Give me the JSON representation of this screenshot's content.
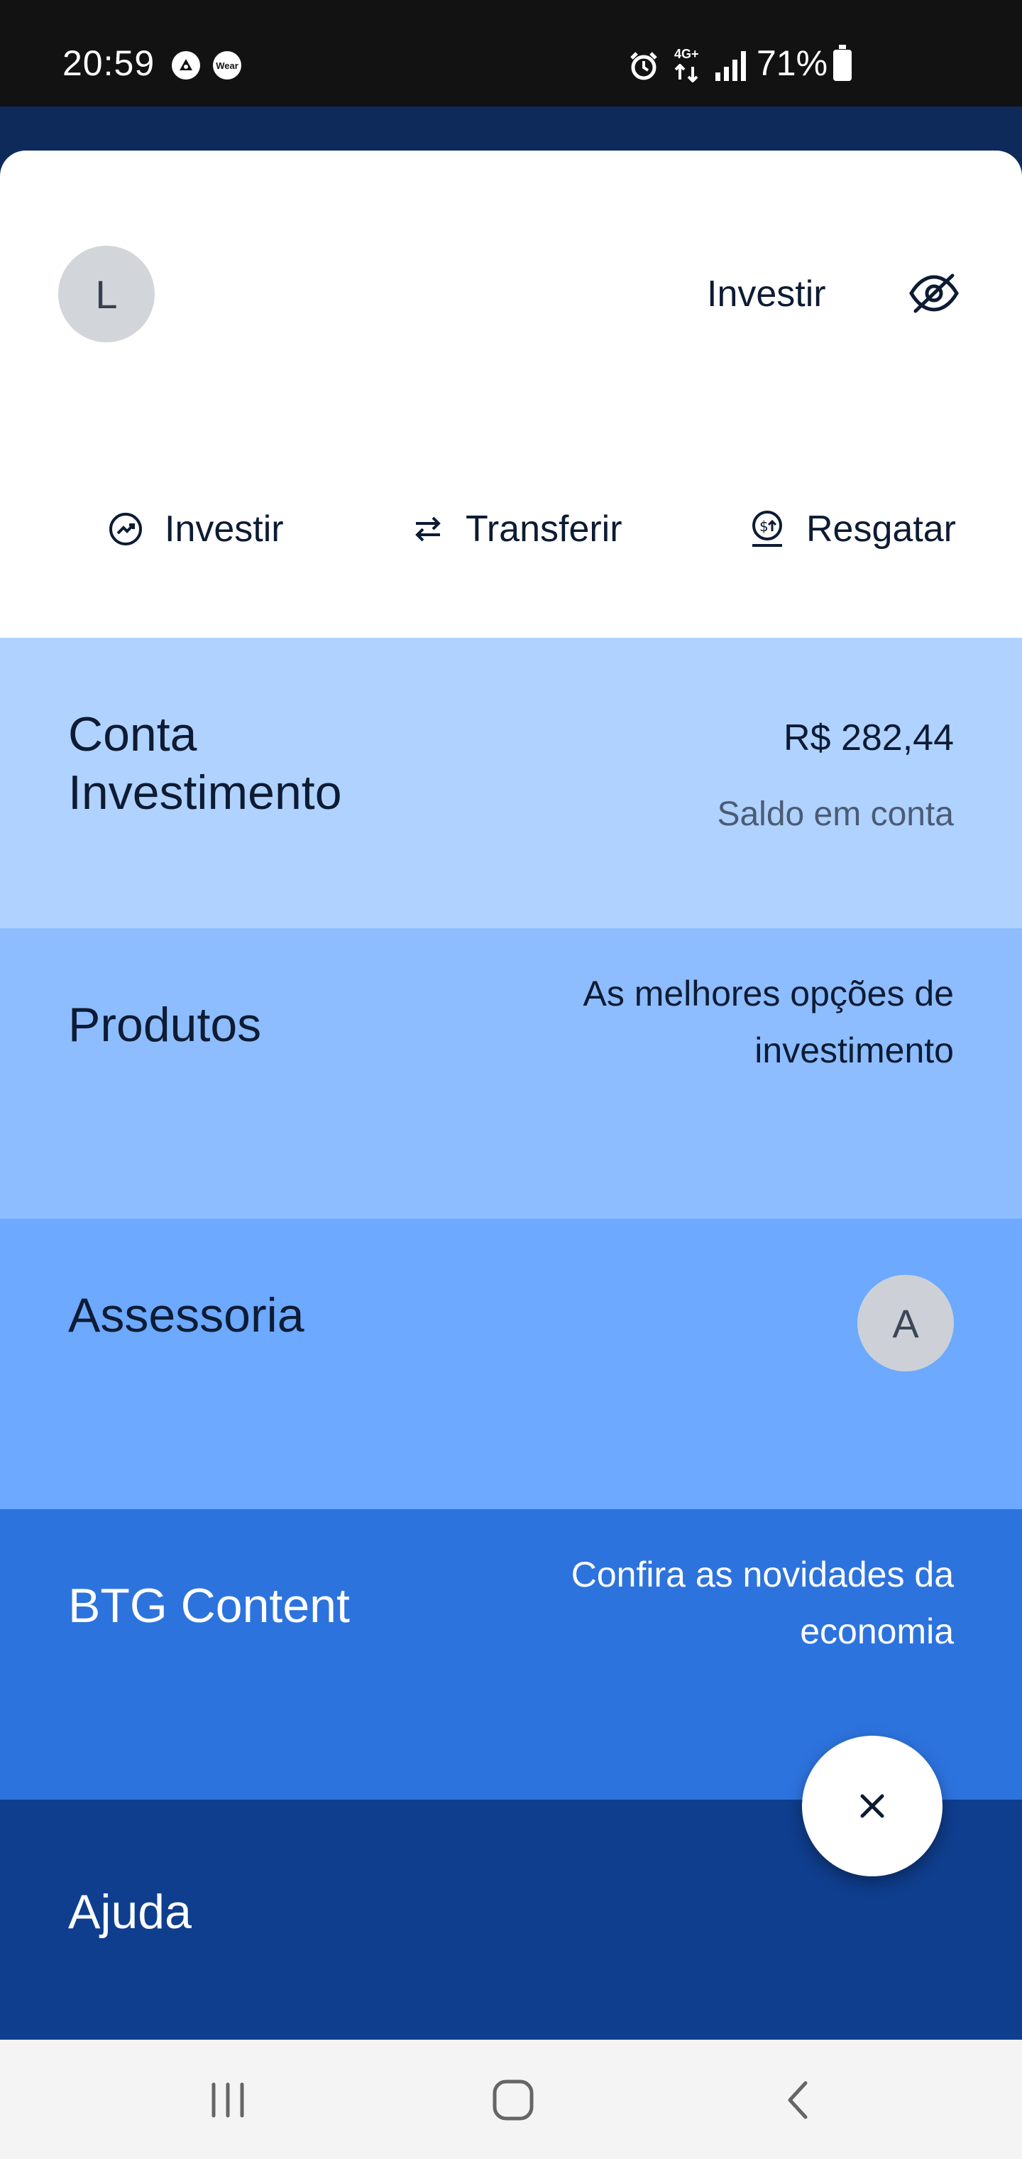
{
  "status_bar": {
    "time": "20:59",
    "left_icons": [
      "app-notification-icon",
      "wear-icon"
    ],
    "wear_label": "Wear",
    "network_label": "4G+",
    "battery_percent": "71%",
    "battery_level": 0.71,
    "icons": [
      "alarm-icon",
      "network-icon",
      "signal-icon",
      "battery-icon"
    ]
  },
  "header": {
    "avatar_initial": "L",
    "invest_link": "Investir",
    "hide_balance_icon": "eye-off-icon"
  },
  "quick_actions": [
    {
      "label": "Investir",
      "icon": "trending-up-icon"
    },
    {
      "label": "Transferir",
      "icon": "transfer-arrows-icon"
    },
    {
      "label": "Resgatar",
      "icon": "withdraw-money-icon"
    }
  ],
  "menu": {
    "conta": {
      "title": "Conta Investimento",
      "balance": "R$ 282,44",
      "caption": "Saldo em conta",
      "color": "#b0d2ff"
    },
    "produtos": {
      "title": "Produtos",
      "subtitle": "As melhores opções de investimento",
      "color": "#8dbdff"
    },
    "assessoria": {
      "title": "Assessoria",
      "advisor_initial": "A",
      "color": "#6ca9ff"
    },
    "btg_content": {
      "title": "BTG Content",
      "subtitle": "Confira as novidades da economia",
      "color": "#2d73de"
    },
    "ajuda": {
      "title": "Ajuda",
      "color": "#0f3e8e"
    }
  },
  "fab": {
    "icon": "close-icon"
  },
  "nav_bar": {
    "icons": [
      "recent-apps-icon",
      "home-icon",
      "back-icon"
    ]
  }
}
